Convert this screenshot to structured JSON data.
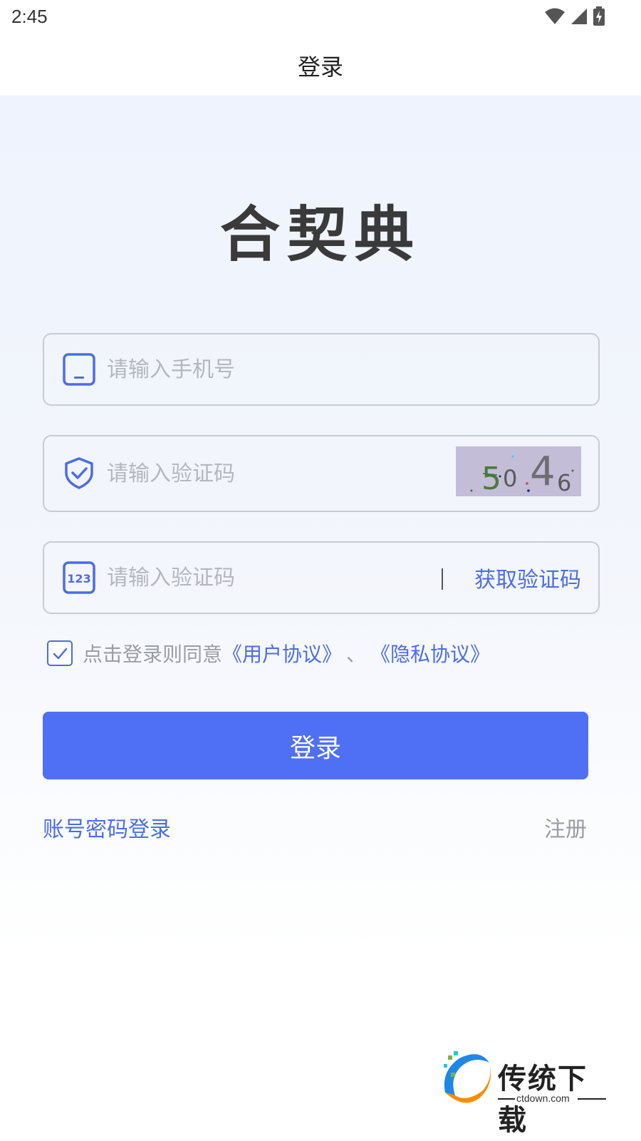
{
  "status_bar": {
    "time": "2:45",
    "icons": [
      "wifi-icon",
      "cellular-signal-icon",
      "battery-charging-icon"
    ]
  },
  "header": {
    "title": "登录"
  },
  "logo": {
    "text": "合契典"
  },
  "form": {
    "phone": {
      "icon": "phone-icon",
      "placeholder": "请输入手机号",
      "value": ""
    },
    "captcha": {
      "icon": "shield-check-icon",
      "placeholder": "请输入验证码",
      "value": "",
      "image_text": "5046",
      "image_bg_color": "#c3bdd8"
    },
    "sms_code": {
      "icon": "numeric-123-icon",
      "icon_text": "123",
      "placeholder": "请输入验证码",
      "value": "",
      "divider": "|",
      "get_code_label": "获取验证码"
    }
  },
  "agreement": {
    "checked": true,
    "prefix": "点击登录则同意",
    "user_agreement": "《用户协议》",
    "separator": "、",
    "privacy_policy": "《隐私协议》"
  },
  "actions": {
    "login_label": "登录",
    "account_login_label": "账号密码登录",
    "register_label": "注册"
  },
  "watermark": {
    "title": "传统下载",
    "subtitle": "ctdown.com"
  },
  "colors": {
    "accent": "#4b6de8",
    "button": "#4f6ff5",
    "placeholder": "#b4b7bd",
    "border": "#c8cbd2",
    "muted_text": "#9a9da3"
  }
}
